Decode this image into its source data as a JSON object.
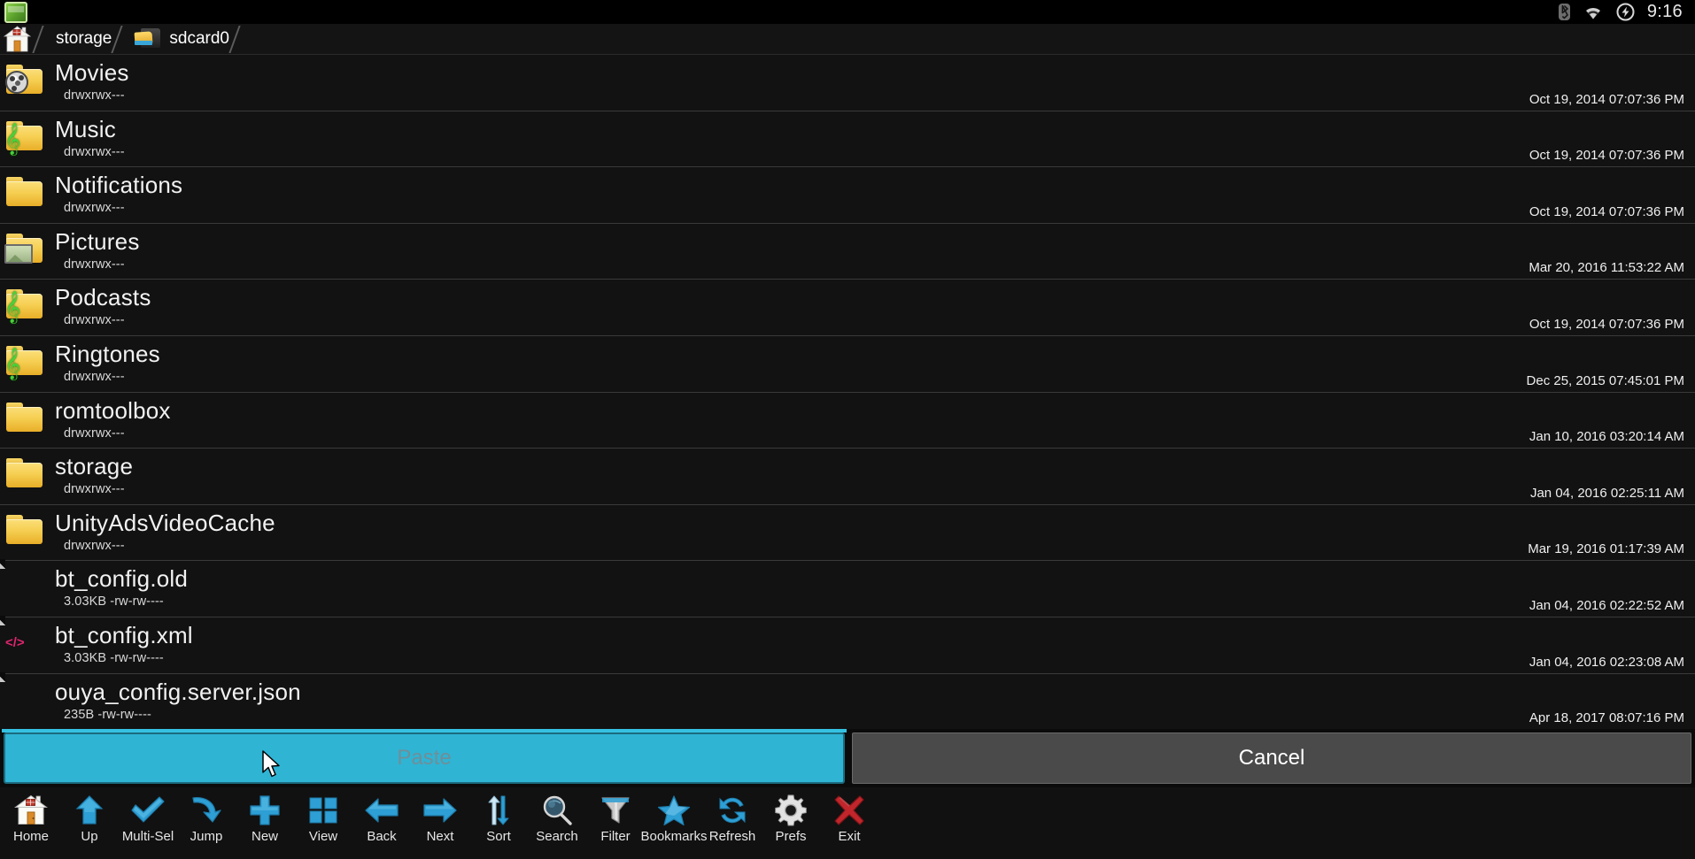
{
  "status_bar": {
    "app_icon": "file-manager-logo",
    "bluetooth_icon": "bluetooth-icon",
    "wifi_icon": "wifi-icon",
    "charging_icon": "charging-icon",
    "time": "9:16"
  },
  "breadcrumb": {
    "home_icon": "home-icon",
    "items": [
      {
        "label": "storage",
        "icon": ""
      },
      {
        "label": "sdcard0",
        "icon": "sdcard-icon"
      }
    ]
  },
  "file_list": {
    "permissions_dir": "drwxrwx---",
    "rows": [
      {
        "name": "Movies",
        "meta": "drwxrwx---",
        "date": "Oct 19, 2014 07:07:36 PM",
        "icon": "folder-movies-icon",
        "type": "folder"
      },
      {
        "name": "Music",
        "meta": "drwxrwx---",
        "date": "Oct 19, 2014 07:07:36 PM",
        "icon": "folder-music-icon",
        "type": "folder"
      },
      {
        "name": "Notifications",
        "meta": "drwxrwx---",
        "date": "Oct 19, 2014 07:07:36 PM",
        "icon": "folder-icon",
        "type": "folder"
      },
      {
        "name": "Pictures",
        "meta": "drwxrwx---",
        "date": "Mar 20, 2016 11:53:22 AM",
        "icon": "folder-pictures-icon",
        "type": "folder"
      },
      {
        "name": "Podcasts",
        "meta": "drwxrwx---",
        "date": "Oct 19, 2014 07:07:36 PM",
        "icon": "folder-music-icon",
        "type": "folder"
      },
      {
        "name": "Ringtones",
        "meta": "drwxrwx---",
        "date": "Dec 25, 2015 07:45:01 PM",
        "icon": "folder-music-icon",
        "type": "folder"
      },
      {
        "name": "romtoolbox",
        "meta": "drwxrwx---",
        "date": "Jan 10, 2016 03:20:14 AM",
        "icon": "folder-icon",
        "type": "folder"
      },
      {
        "name": "storage",
        "meta": "drwxrwx---",
        "date": "Jan 04, 2016 02:25:11 AM",
        "icon": "folder-icon",
        "type": "folder"
      },
      {
        "name": "UnityAdsVideoCache",
        "meta": "drwxrwx---",
        "date": "Mar 19, 2016 01:17:39 AM",
        "icon": "folder-icon",
        "type": "folder"
      },
      {
        "name": "bt_config.old",
        "meta": "3.03KB -rw-rw----",
        "date": "Jan 04, 2016 02:22:52 AM",
        "icon": "file-icon",
        "type": "file"
      },
      {
        "name": "bt_config.xml",
        "meta": "3.03KB -rw-rw----",
        "date": "Jan 04, 2016 02:23:08 AM",
        "icon": "file-xml-icon",
        "type": "file",
        "code_glyph": "</>"
      },
      {
        "name": "ouya_config.server.json",
        "meta": "235B -rw-rw----",
        "date": "Apr 18, 2017 08:07:16 PM",
        "icon": "file-icon",
        "type": "file"
      }
    ]
  },
  "action_bar": {
    "paste_label": "Paste",
    "cancel_label": "Cancel",
    "paste_color": "#2fb4d4",
    "paste_text_color": "#6f8f99",
    "cancel_color": "#4a4a4a"
  },
  "toolbar": {
    "items": [
      {
        "label": "Home",
        "icon": "home-icon"
      },
      {
        "label": "Up",
        "icon": "arrow-up-icon"
      },
      {
        "label": "Multi-Sel",
        "icon": "checkmark-icon"
      },
      {
        "label": "Jump",
        "icon": "curved-arrow-icon"
      },
      {
        "label": "New",
        "icon": "plus-icon"
      },
      {
        "label": "View",
        "icon": "grid-icon"
      },
      {
        "label": "Back",
        "icon": "arrow-left-icon"
      },
      {
        "label": "Next",
        "icon": "arrow-right-icon"
      },
      {
        "label": "Sort",
        "icon": "sort-icon"
      },
      {
        "label": "Search",
        "icon": "search-icon"
      },
      {
        "label": "Filter",
        "icon": "filter-icon"
      },
      {
        "label": "Bookmarks",
        "icon": "star-icon"
      },
      {
        "label": "Refresh",
        "icon": "refresh-icon"
      },
      {
        "label": "Prefs",
        "icon": "gear-icon"
      },
      {
        "label": "Exit",
        "icon": "close-x-icon"
      }
    ],
    "accent_color": "#2e9fd4",
    "exit_color": "#c0262b"
  },
  "cursor": {
    "icon": "mouse-cursor"
  }
}
